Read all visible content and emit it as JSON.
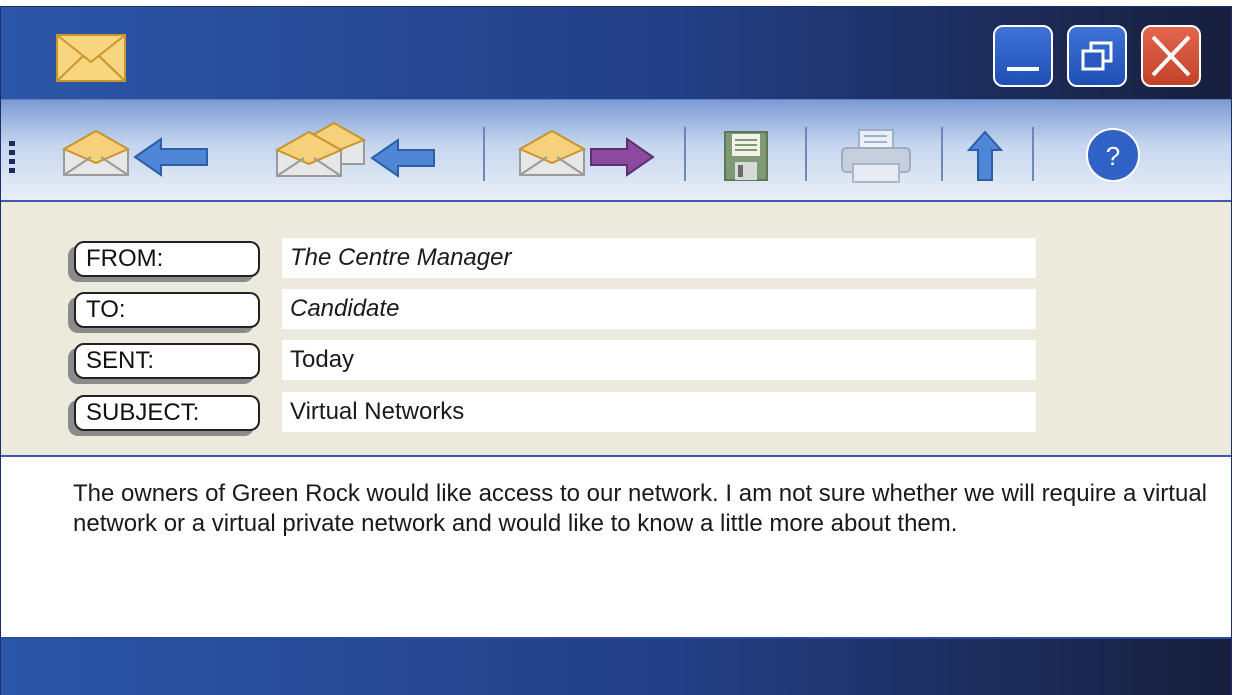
{
  "titlebar": {
    "app_icon": "envelope-icon",
    "buttons": [
      {
        "name": "minimize",
        "icon": "minimize-icon"
      },
      {
        "name": "maximize",
        "icon": "restore-icon"
      },
      {
        "name": "close",
        "icon": "close-icon"
      }
    ]
  },
  "toolbar": {
    "items": [
      {
        "name": "reply",
        "icon": "reply-icon"
      },
      {
        "name": "reply-all",
        "icon": "reply-all-icon"
      },
      {
        "name": "forward",
        "icon": "forward-icon"
      },
      {
        "name": "save",
        "icon": "floppy-disk-icon"
      },
      {
        "name": "print",
        "icon": "printer-icon"
      },
      {
        "name": "up",
        "icon": "up-arrow-icon"
      },
      {
        "name": "help",
        "icon": "help-icon",
        "label": "?"
      }
    ]
  },
  "header": {
    "from_label": "FROM:",
    "from_value": "The Centre Manager",
    "to_label": "TO:",
    "to_value": "Candidate",
    "sent_label": "SENT:",
    "sent_value": "Today",
    "subject_label": "SUBJECT:",
    "subject_value": "Virtual Networks"
  },
  "message": {
    "body": "The owners of Green Rock would like access to our network. I am not sure whether we will require a virtual network or a virtual private network and would like to know a little more about them."
  },
  "colors": {
    "title_gradient_start": "#2c56a8",
    "title_gradient_end": "#171f3c",
    "close_button": "#d2533b",
    "header_panel": "#ebeadc",
    "envelope": "#f6d07a",
    "arrow_blue": "#4f87d6",
    "arrow_purple": "#8b4a9e"
  }
}
